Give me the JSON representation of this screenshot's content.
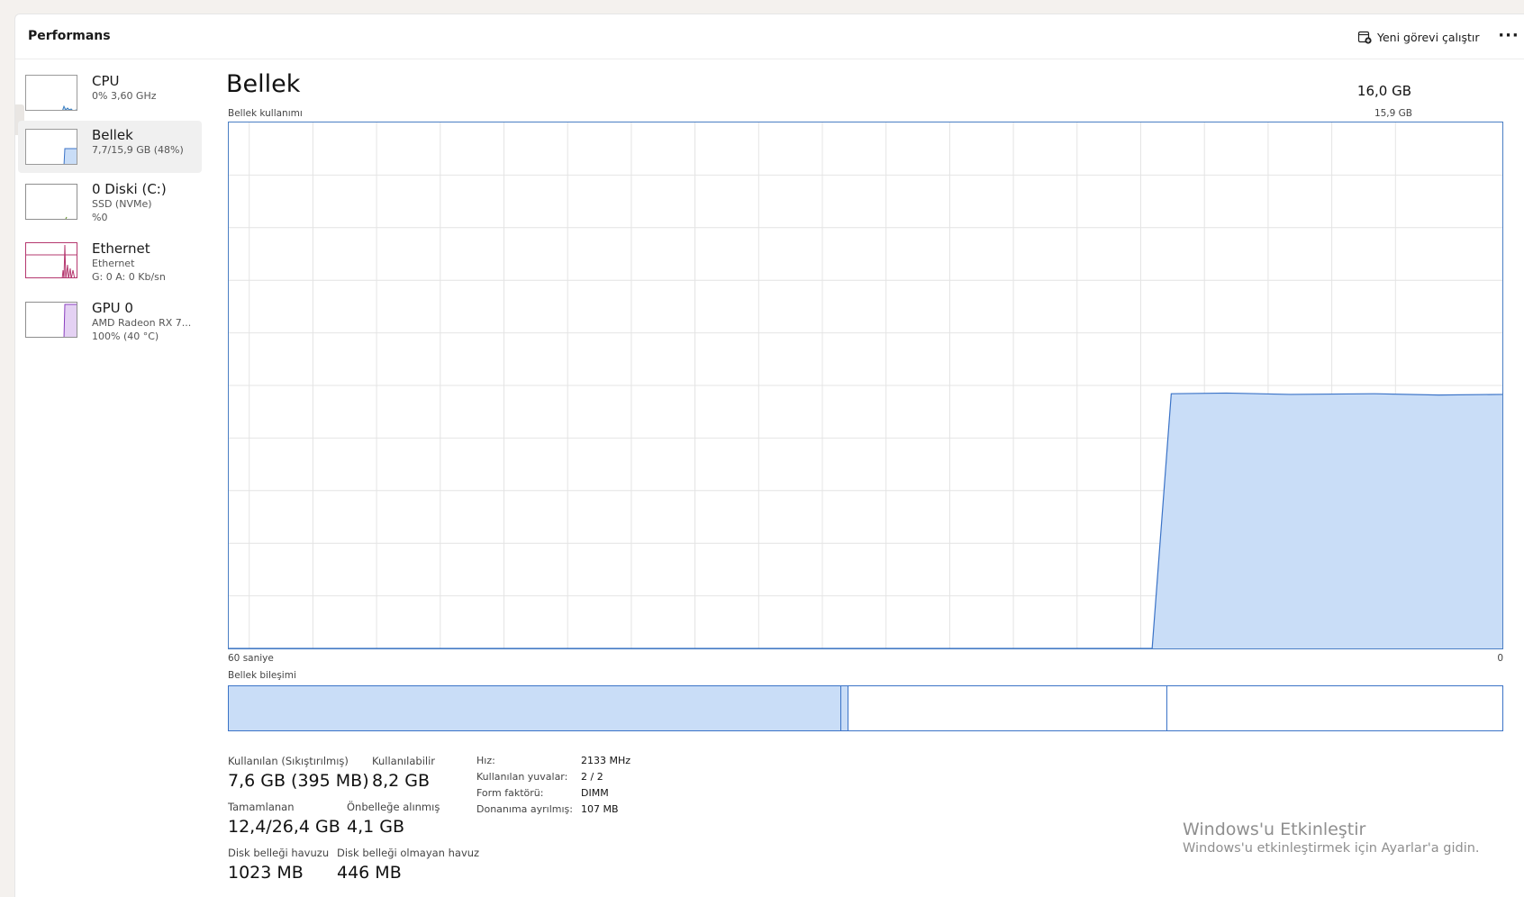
{
  "header": {
    "title": "Performans",
    "run_task_label": "Yeni görevi çalıştır",
    "more_label": "···"
  },
  "sidebar": {
    "items": [
      {
        "name": "CPU",
        "line1": "0% 3,60 GHz",
        "line2": ""
      },
      {
        "name": "Bellek",
        "line1": "7,7/15,9 GB (48%)",
        "line2": ""
      },
      {
        "name": "0 Diski (C:)",
        "line1": "SSD (NVMe)",
        "line2": "%0"
      },
      {
        "name": "Ethernet",
        "line1": "Ethernet",
        "line2": "G: 0 A: 0 Kb/sn"
      },
      {
        "name": "GPU 0",
        "line1": "AMD Radeon RX 7...",
        "line2": "100% (40 °C)"
      }
    ]
  },
  "main": {
    "title": "Bellek",
    "total": "16,0 GB",
    "usage_label": "Bellek kullanımı",
    "usage_max": "15,9 GB",
    "time_left": "60 saniye",
    "time_right": "0",
    "composition_label": "Bellek bileşimi",
    "composition": [
      {
        "fraction": 0.48
      },
      {
        "fraction": 0.006
      },
      {
        "fraction": 0.25
      },
      {
        "fraction": 0.264
      }
    ]
  },
  "stats": {
    "in_use_label": "Kullanılan (Sıkıştırılmış)",
    "in_use_value": "7,6 GB (395 MB)",
    "available_label": "Kullanılabilir",
    "available_value": "8,2 GB",
    "committed_label": "Tamamlanan",
    "committed_value": "12,4/26,4 GB",
    "cached_label": "Önbelleğe alınmış",
    "cached_value": "4,1 GB",
    "paged_label": "Disk belleği havuzu",
    "paged_value": "1023 MB",
    "nonpaged_label": "Disk belleği olmayan havuz",
    "nonpaged_value": "446 MB"
  },
  "specs": {
    "speed_label": "Hız:",
    "speed_value": "2133 MHz",
    "slots_label": "Kullanılan yuvalar:",
    "slots_value": "2 / 2",
    "form_label": "Form faktörü:",
    "form_value": "DIMM",
    "reserved_label": "Donanıma ayrılmış:",
    "reserved_value": "107 MB"
  },
  "watermark": {
    "title": "Windows'u Etkinleştir",
    "subtitle": "Windows'u etkinleştirmek için Ayarlar'a gidin."
  },
  "chart_data": {
    "type": "area",
    "x_range": [
      60,
      0
    ],
    "ylim": [
      0,
      15.9
    ],
    "grid": true,
    "color": "#c9ddf7",
    "line_color": "#3b73c7",
    "x": [
      60,
      16.5,
      15.6,
      13,
      10,
      6,
      3,
      0
    ],
    "y": [
      0,
      0,
      7.7,
      7.72,
      7.68,
      7.7,
      7.66,
      7.68
    ]
  },
  "colors": {
    "accent": "#3b73c7",
    "fill": "#c9ddf7",
    "ethernet": "#b5386f",
    "gpu": "#8a3fbf"
  }
}
